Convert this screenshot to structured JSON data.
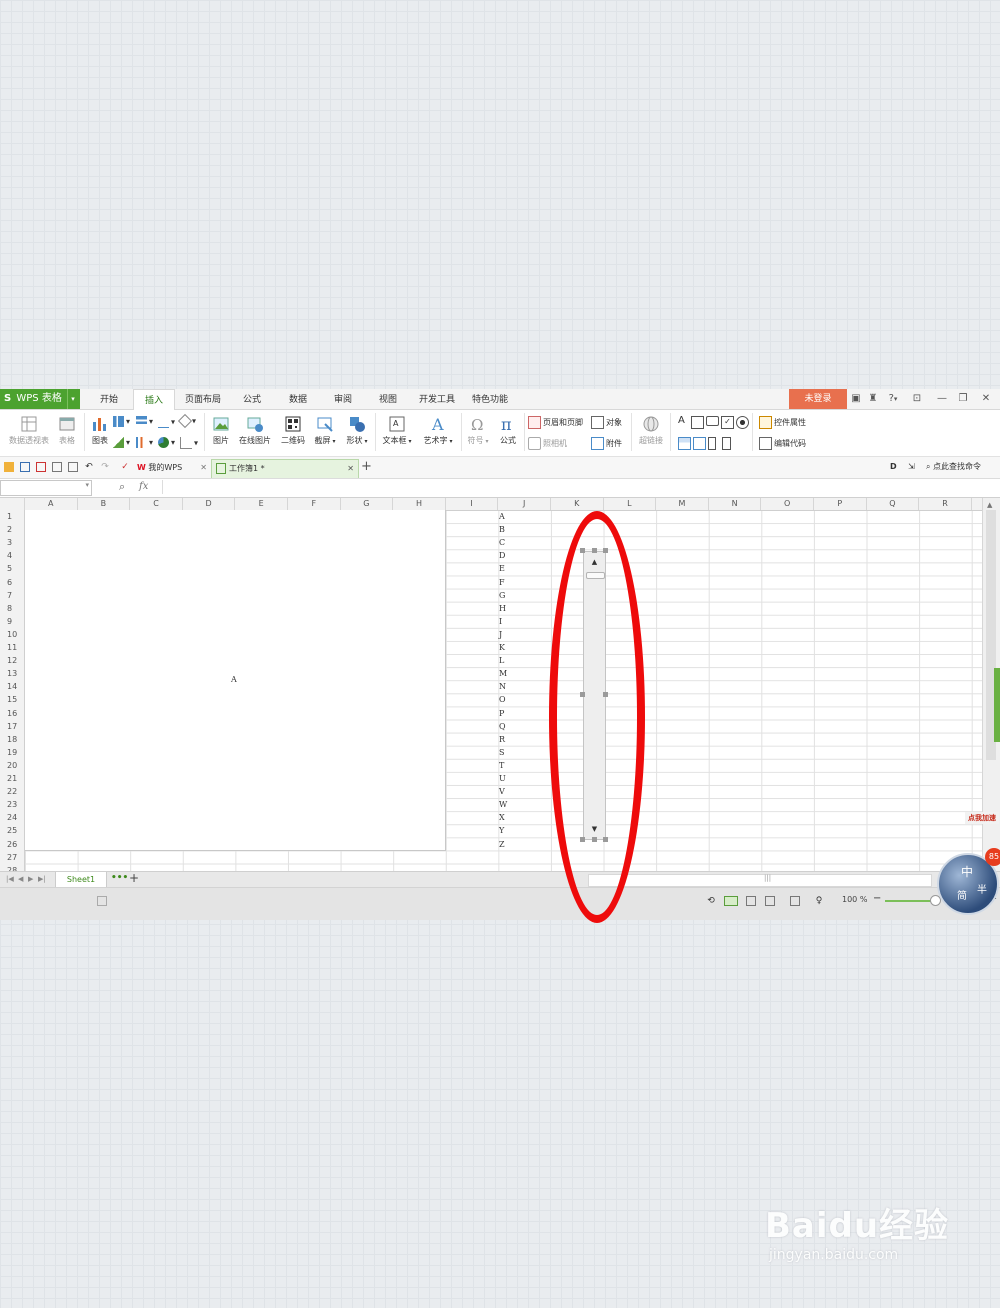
{
  "app": {
    "brand": "WPS 表格"
  },
  "menu_tabs": [
    {
      "label": "开始"
    },
    {
      "label": "插入"
    },
    {
      "label": "页面布局"
    },
    {
      "label": "公式"
    },
    {
      "label": "数据"
    },
    {
      "label": "审阅"
    },
    {
      "label": "视图"
    },
    {
      "label": "开发工具"
    },
    {
      "label": "特色功能"
    }
  ],
  "active_tab": "插入",
  "login_label": "未登录",
  "window_controls": {
    "help": "?"
  },
  "ribbon": {
    "pivot_table": "数据透视表",
    "table": "表格",
    "chart": "图表",
    "picture": "图片",
    "online_picture": "在线图片",
    "qrcode": "二维码",
    "screenshot": "截屏",
    "shape": "形状",
    "textbox": "文本框",
    "wordart": "艺术字",
    "symbol": "符号",
    "formula": "公式",
    "header_footer": "页眉和页脚",
    "camera": "照相机",
    "object": "对象",
    "attachment": "附件",
    "hyperlink": "超链接",
    "form_a": "A",
    "control_props": "控件属性",
    "view_code": "编辑代码"
  },
  "quickbar": {
    "my_wps": "我的WPS",
    "workbook_tab": "工作簿1 *",
    "search_cmd": "点此查找命令"
  },
  "formula_bar": {
    "fx": "fx",
    "name_box": "",
    "content": ""
  },
  "columns": [
    "A",
    "B",
    "C",
    "D",
    "E",
    "F",
    "G",
    "H",
    "I",
    "J",
    "K",
    "L",
    "M",
    "N",
    "O",
    "P",
    "Q",
    "R"
  ],
  "rows": [
    "1",
    "2",
    "3",
    "4",
    "5",
    "6",
    "7",
    "8",
    "9",
    "10",
    "11",
    "12",
    "13",
    "14",
    "15",
    "16",
    "17",
    "18",
    "19",
    "20",
    "21",
    "22",
    "23",
    "24",
    "25",
    "26",
    "27",
    "28"
  ],
  "merged_cell_value": "A",
  "column_j_values": [
    "A",
    "B",
    "C",
    "D",
    "E",
    "F",
    "G",
    "H",
    "I",
    "J",
    "K",
    "L",
    "M",
    "N",
    "O",
    "P",
    "Q",
    "R",
    "S",
    "T",
    "U",
    "V",
    "W",
    "X",
    "Y",
    "Z"
  ],
  "sheet_tabs": [
    {
      "label": "Sheet1"
    }
  ],
  "sheet_more": "•••",
  "add_sheet": "+",
  "status": {
    "zoom": "100 %"
  },
  "float_widget": {
    "badge": "85",
    "tag": "点我加速",
    "ball_text_1": "中",
    "ball_text_2": "简",
    "ball_text_3": "半"
  },
  "watermark": {
    "brand": "Baidu经验",
    "url": "jingyan.baidu.com"
  },
  "colors": {
    "accent": "#4ca22f",
    "login": "#e8704e",
    "highlight": "#ee0b0b"
  }
}
